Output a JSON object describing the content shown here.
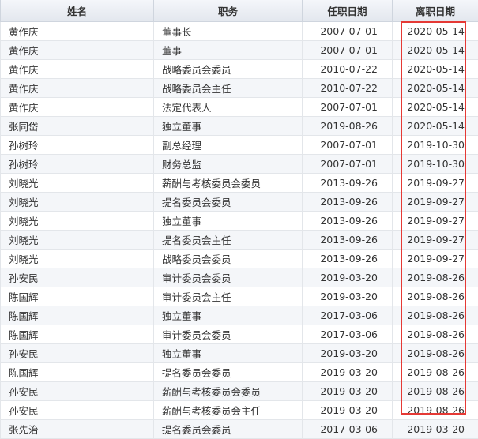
{
  "headers": {
    "name": "姓名",
    "position": "职务",
    "start": "任职日期",
    "end": "离职日期"
  },
  "rows": [
    {
      "name": "黄作庆",
      "position": "董事长",
      "start": "2007-07-01",
      "end": "2020-05-14"
    },
    {
      "name": "黄作庆",
      "position": "董事",
      "start": "2007-07-01",
      "end": "2020-05-14"
    },
    {
      "name": "黄作庆",
      "position": "战略委员会委员",
      "start": "2010-07-22",
      "end": "2020-05-14"
    },
    {
      "name": "黄作庆",
      "position": "战略委员会主任",
      "start": "2010-07-22",
      "end": "2020-05-14"
    },
    {
      "name": "黄作庆",
      "position": "法定代表人",
      "start": "2007-07-01",
      "end": "2020-05-14"
    },
    {
      "name": "张同岱",
      "position": "独立董事",
      "start": "2019-08-26",
      "end": "2020-05-14"
    },
    {
      "name": "孙树玲",
      "position": "副总经理",
      "start": "2007-07-01",
      "end": "2019-10-30"
    },
    {
      "name": "孙树玲",
      "position": "财务总监",
      "start": "2007-07-01",
      "end": "2019-10-30"
    },
    {
      "name": "刘晓光",
      "position": "薪酬与考核委员会委员",
      "start": "2013-09-26",
      "end": "2019-09-27"
    },
    {
      "name": "刘晓光",
      "position": "提名委员会委员",
      "start": "2013-09-26",
      "end": "2019-09-27"
    },
    {
      "name": "刘晓光",
      "position": "独立董事",
      "start": "2013-09-26",
      "end": "2019-09-27"
    },
    {
      "name": "刘晓光",
      "position": "提名委员会主任",
      "start": "2013-09-26",
      "end": "2019-09-27"
    },
    {
      "name": "刘晓光",
      "position": "战略委员会委员",
      "start": "2013-09-26",
      "end": "2019-09-27"
    },
    {
      "name": "孙安民",
      "position": "审计委员会委员",
      "start": "2019-03-20",
      "end": "2019-08-26"
    },
    {
      "name": "陈国辉",
      "position": "审计委员会主任",
      "start": "2019-03-20",
      "end": "2019-08-26"
    },
    {
      "name": "陈国辉",
      "position": "独立董事",
      "start": "2017-03-06",
      "end": "2019-08-26"
    },
    {
      "name": "陈国辉",
      "position": "审计委员会委员",
      "start": "2017-03-06",
      "end": "2019-08-26"
    },
    {
      "name": "孙安民",
      "position": "独立董事",
      "start": "2019-03-20",
      "end": "2019-08-26"
    },
    {
      "name": "陈国辉",
      "position": "提名委员会委员",
      "start": "2019-03-20",
      "end": "2019-08-26"
    },
    {
      "name": "孙安民",
      "position": "薪酬与考核委员会委员",
      "start": "2019-03-20",
      "end": "2019-08-26"
    },
    {
      "name": "孙安民",
      "position": "薪酬与考核委员会主任",
      "start": "2019-03-20",
      "end": "2019-08-26"
    },
    {
      "name": "张先治",
      "position": "提名委员会委员",
      "start": "2017-03-06",
      "end": "2019-03-20"
    }
  ],
  "colors": {
    "highlight_border": "#e53935"
  }
}
